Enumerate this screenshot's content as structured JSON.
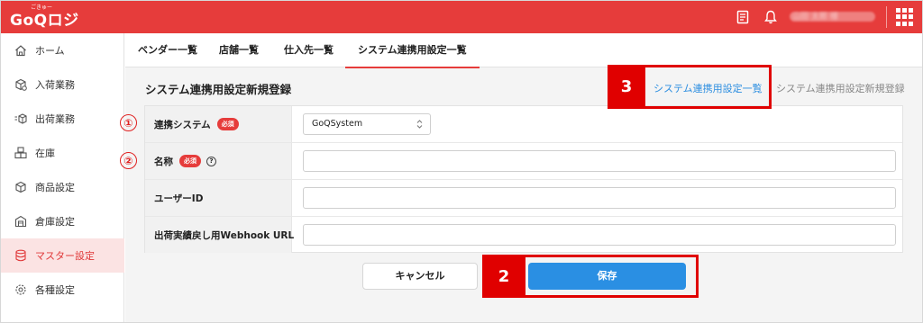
{
  "app": {
    "logo_text": "GoQロジ",
    "logo_ruby": "ごきゅー",
    "user_name": "山田 太郎 様",
    "colors": {
      "brand": "#e63c3b",
      "primary": "#2a8fe3",
      "active_bg": "#fbe3e3"
    }
  },
  "header": {
    "icons": [
      "document-icon",
      "bell-icon",
      "apps-grid-icon"
    ]
  },
  "sidebar": {
    "items": [
      {
        "label": "ホーム",
        "icon": "home-icon"
      },
      {
        "label": "入荷業務",
        "icon": "inbound-icon"
      },
      {
        "label": "出荷業務",
        "icon": "outbound-icon"
      },
      {
        "label": "在庫",
        "icon": "stock-icon"
      },
      {
        "label": "商品設定",
        "icon": "product-icon"
      },
      {
        "label": "倉庫設定",
        "icon": "warehouse-icon"
      },
      {
        "label": "マスター設定",
        "icon": "database-icon",
        "active": true
      },
      {
        "label": "各種設定",
        "icon": "gear-icon"
      }
    ]
  },
  "tabs": [
    {
      "label": "ベンダー一覧"
    },
    {
      "label": "店舗一覧"
    },
    {
      "label": "仕入先一覧"
    },
    {
      "label": "システム連携用設定一覧",
      "active": true
    }
  ],
  "page": {
    "title": "システム連携用設定新規登録",
    "breadcrumb": {
      "parent": "システム連携用設定一覧",
      "separator": "",
      "current": "システム連携用設定新規登録"
    }
  },
  "form": {
    "required_badge": "必須",
    "help_glyph": "?",
    "rows": [
      {
        "label": "連携システム",
        "required": true,
        "type": "select",
        "value": "GoQSystem"
      },
      {
        "label": "名称",
        "required": true,
        "help": true,
        "type": "text",
        "value": ""
      },
      {
        "label": "ユーザーID",
        "required": false,
        "type": "text",
        "value": ""
      },
      {
        "label": "出荷実績戻し用Webhook URL",
        "required": false,
        "type": "text",
        "value": ""
      }
    ]
  },
  "buttons": {
    "cancel": "キャンセル",
    "save": "保存"
  },
  "annotations": {
    "circle_1": "①",
    "circle_2": "②",
    "box_2": "2",
    "box_3": "3"
  }
}
